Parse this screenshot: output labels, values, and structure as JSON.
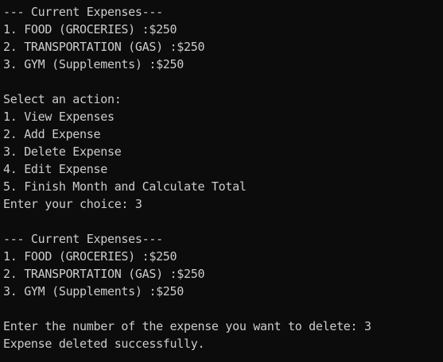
{
  "theme": {
    "background": "#0c0c0c",
    "foreground": "#cccccc"
  },
  "console": {
    "lines": [
      "--- Current Expenses---",
      "1. FOOD (GROCERIES) :$250",
      "2. TRANSPORTATION (GAS) :$250",
      "3. GYM (Supplements) :$250",
      "",
      "Select an action:",
      "1. View Expenses",
      "2. Add Expense",
      "3. Delete Expense",
      "4. Edit Expense",
      "5. Finish Month and Calculate Total",
      "Enter your choice: 3",
      "",
      "--- Current Expenses---",
      "1. FOOD (GROCERIES) :$250",
      "2. TRANSPORTATION (GAS) :$250",
      "3. GYM (Supplements) :$250",
      "",
      "Enter the number of the expense you want to delete: 3",
      "Expense deleted successfully."
    ]
  }
}
